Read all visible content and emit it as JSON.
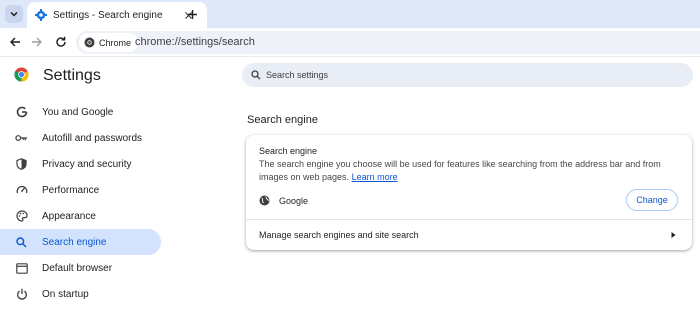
{
  "browser": {
    "tab_title": "Settings - Search engine",
    "site_chip_label": "Chrome",
    "url": "chrome://settings/search"
  },
  "settings": {
    "title": "Settings",
    "search_placeholder": "Search settings"
  },
  "sidebar": {
    "items": [
      {
        "label": "You and Google",
        "icon": "google-g-icon"
      },
      {
        "label": "Autofill and passwords",
        "icon": "key-icon"
      },
      {
        "label": "Privacy and security",
        "icon": "shield-icon"
      },
      {
        "label": "Performance",
        "icon": "speedometer-icon"
      },
      {
        "label": "Appearance",
        "icon": "palette-icon"
      },
      {
        "label": "Search engine",
        "icon": "search-icon",
        "active": true
      },
      {
        "label": "Default browser",
        "icon": "browser-window-icon"
      },
      {
        "label": "On startup",
        "icon": "power-icon"
      }
    ]
  },
  "main": {
    "section_heading": "Search engine",
    "card": {
      "title": "Search engine",
      "description": "The search engine you choose will be used for features like searching from the address bar and from images on web pages.",
      "learn_more": "Learn more",
      "engine_name": "Google",
      "change_label": "Change",
      "manage_label": "Manage search engines and site search"
    }
  },
  "colors": {
    "accent": "#0b57d0",
    "active_nav_bg": "#d3e3fd",
    "tabstrip_bg": "#dfe8f8"
  }
}
